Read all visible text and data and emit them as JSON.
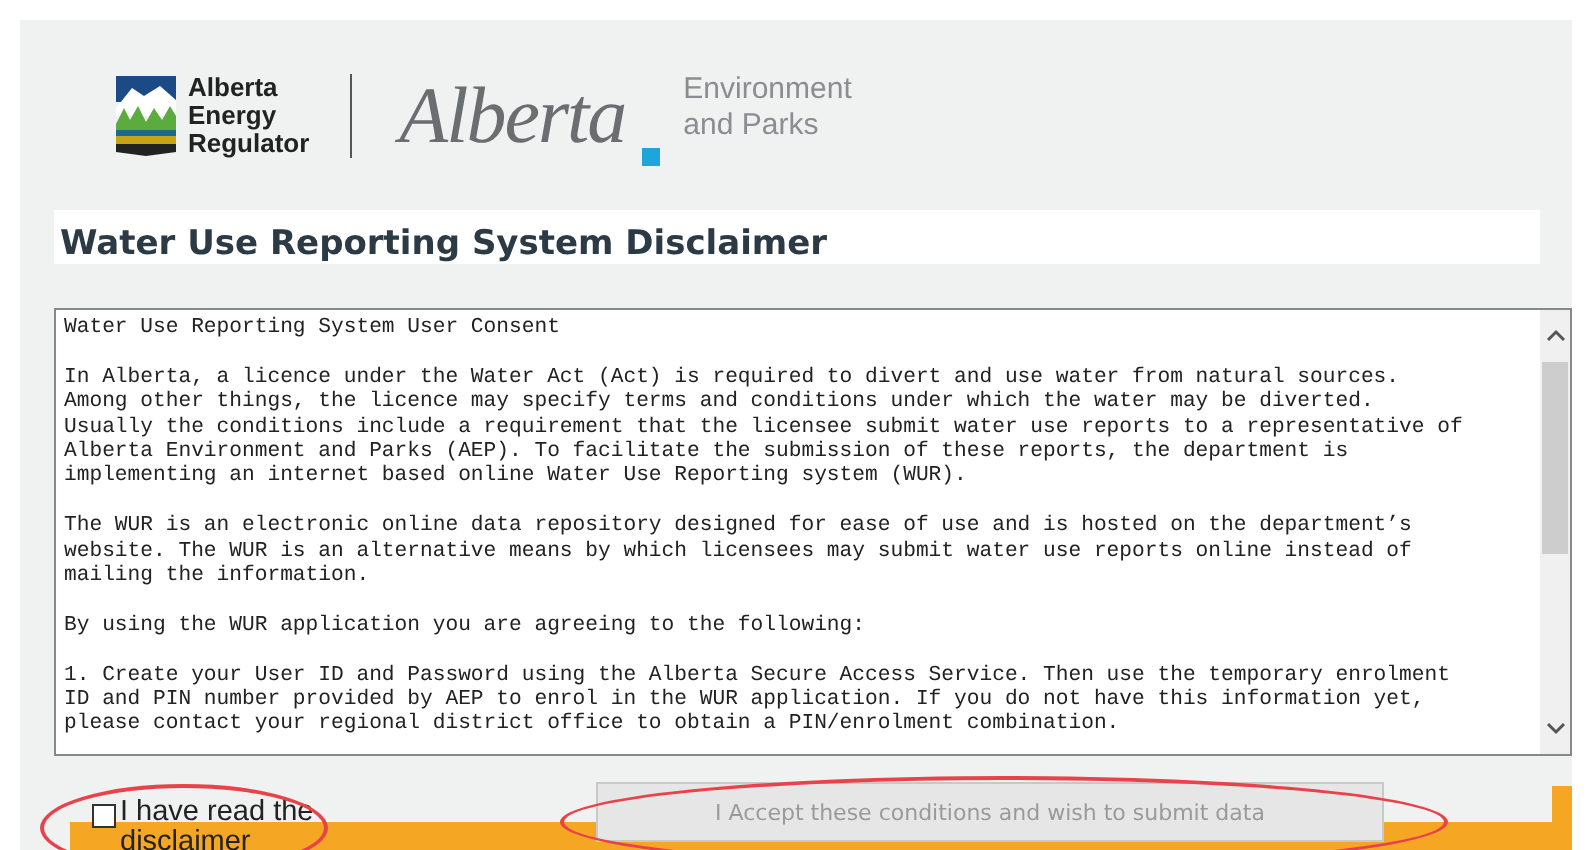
{
  "header": {
    "regulator_logo": [
      "Alberta",
      "Energy",
      "Regulator"
    ],
    "ministry_wordmark": "Alberta",
    "ministry_name": [
      "Environment",
      "and Parks"
    ]
  },
  "page_title": "Water Use Reporting System Disclaimer",
  "disclaimer": {
    "paragraphs": [
      [
        "Water Use Reporting System User Consent"
      ],
      [
        "In Alberta, a licence under the Water Act (Act) is required to divert and use water from natural sources.",
        "Among other things, the licence may specify terms and conditions under which the water may be diverted.",
        "Usually the conditions include a requirement that the licensee submit water use reports to a representative of",
        "Alberta Environment and Parks (AEP). To facilitate the submission of these reports, the department is",
        "implementing an internet based online Water Use Reporting system (WUR)."
      ],
      [
        "The WUR is an electronic online data repository designed for ease of use and is hosted on the department’s",
        "website. The WUR is an alternative means by which licensees may submit water use reports online instead of",
        "mailing the information."
      ],
      [
        "By using the WUR application you are agreeing to the following:"
      ],
      [
        "1. Create your User ID and Password using the Alberta Secure Access Service. Then use the temporary enrolment",
        "ID and PIN number provided by AEP to enrol in the WUR application. If you do not have this information yet,",
        "please contact your regional district office to obtain a PIN/enrolment combination."
      ]
    ]
  },
  "read_checkbox": {
    "label": "I have read the disclaimer",
    "checked": false
  },
  "accept_button": {
    "label": "I Accept these conditions and wish to submit data",
    "disabled": true
  }
}
